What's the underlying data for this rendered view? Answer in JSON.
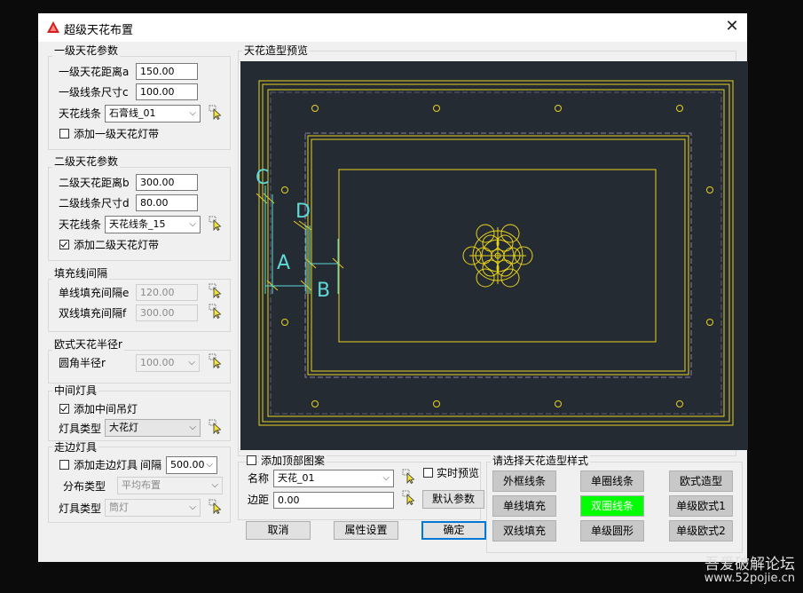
{
  "title": "超级天花布置",
  "close_glyph": "✕",
  "level1": {
    "group": "一级天花参数",
    "dist_label": "一级天花距离a",
    "dist_value": "150.00",
    "line_size_label": "一级线条尺寸c",
    "line_size_value": "100.00",
    "line_type_label": "天花线条",
    "line_type_value": "石膏线_01",
    "light_strip_label": "添加一级天花灯带",
    "light_strip_checked": false
  },
  "level2": {
    "group": "二级天花参数",
    "dist_label": "二级天花距离b",
    "dist_value": "300.00",
    "line_size_label": "二级线条尺寸d",
    "line_size_value": "80.00",
    "line_type_label": "天花线条",
    "line_type_value": "天花线条_15",
    "light_strip_label": "添加二级天花灯带",
    "light_strip_checked": true
  },
  "fill": {
    "group": "填充线间隔",
    "single_label": "单线填充间隔e",
    "single_value": "120.00",
    "double_label": "双线填充间隔f",
    "double_value": "300.00"
  },
  "euro": {
    "group": "欧式天花半径r",
    "radius_label": "圆角半径r",
    "radius_value": "100.00"
  },
  "center_light": {
    "group": "中间灯具",
    "add_label": "添加中间吊灯",
    "add_checked": true,
    "type_label": "灯具类型",
    "type_value": "大花灯"
  },
  "aisle_light": {
    "group": "走边灯具",
    "add_label": "添加走边灯具",
    "add_checked": false,
    "spacing_label": "间隔",
    "spacing_value": "500.00",
    "dist_type_label": "分布类型",
    "dist_type_value": "平均布置",
    "type_label": "灯具类型",
    "type_value": "筒灯"
  },
  "preview": {
    "group": "天花造型预览",
    "marks": {
      "A": "A",
      "B": "B",
      "C": "C",
      "D": "D"
    }
  },
  "top_pattern": {
    "add_label": "添加顶部图案",
    "add_checked": false,
    "name_label": "名称",
    "name_value": "天花_01",
    "margin_label": "边距",
    "margin_value": "0.00",
    "realtime_label": "实时预览",
    "realtime_checked": false,
    "default_button": "默认参数"
  },
  "buttons": {
    "cancel": "取消",
    "props": "属性设置",
    "ok": "确定"
  },
  "styles": {
    "group": "请选择天花造型样式",
    "items": [
      "外框线条",
      "单圈线条",
      "欧式造型",
      "单线填充",
      "双圈线条",
      "单级欧式1",
      "双线填充",
      "单级圆形",
      "单级欧式2"
    ],
    "selected": "双圈线条"
  },
  "watermark": {
    "line1": "吾爱破解论坛",
    "line2": "www.52pojie.cn"
  },
  "colors": {
    "preview_bg": "#252b33",
    "cad_yellow": "#e8d21c",
    "cad_cyan": "#5fd8d6",
    "selected": "#00ff00"
  },
  "icons": {
    "app": "autocad-icon",
    "pick": "pick-cursor-icon"
  }
}
